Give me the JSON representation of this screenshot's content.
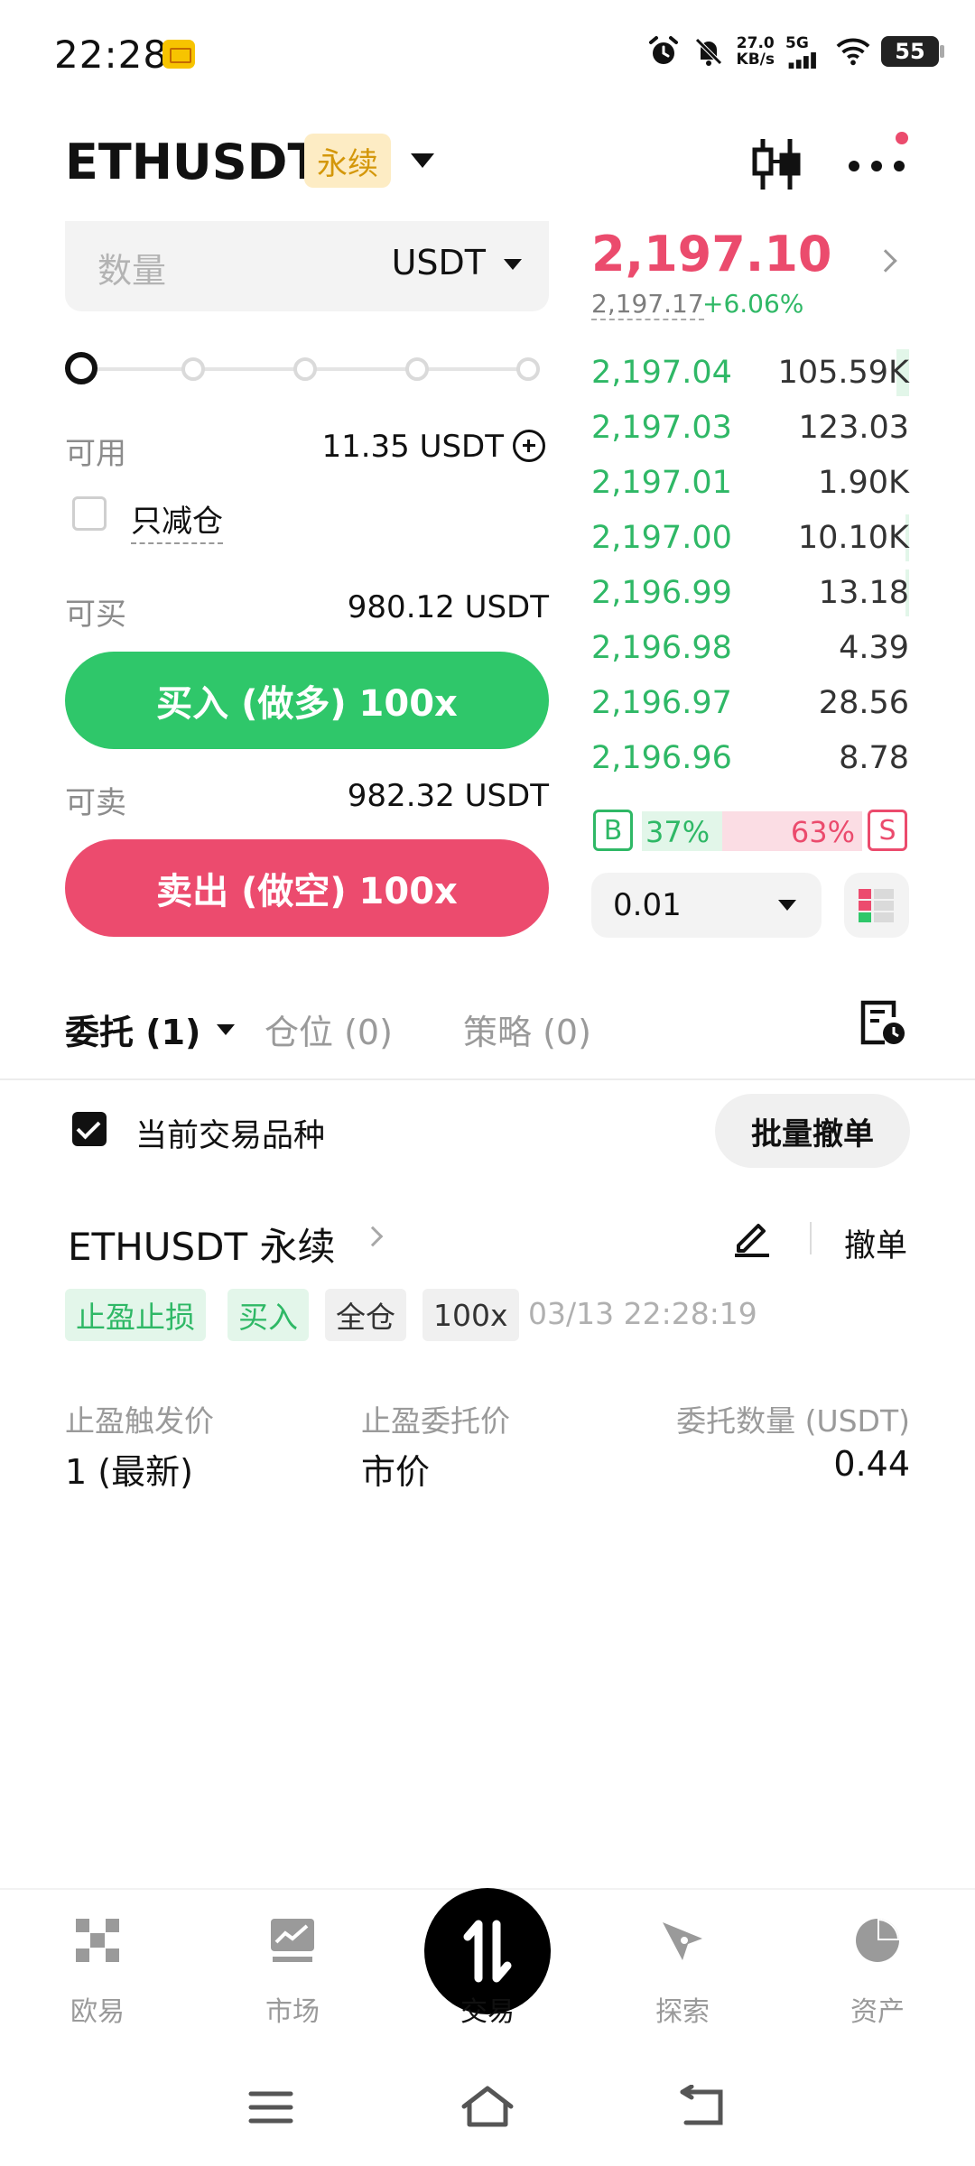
{
  "status_bar": {
    "time": "22:28",
    "net_speed_value": "27.0",
    "net_speed_unit": "KB/s",
    "network": "5G",
    "battery": "55"
  },
  "header": {
    "symbol": "ETHUSDT",
    "contract_type": "永续"
  },
  "order_form": {
    "quantity_placeholder": "数量",
    "quantity_unit": "USDT",
    "slider_value": 0,
    "available_label": "可用",
    "available_value": "11.35 USDT",
    "reduce_only_label": "只减仓",
    "buyable_label": "可买",
    "buyable_value": "980.12 USDT",
    "buy_button": "买入 (做多) 100x",
    "sellable_label": "可卖",
    "sellable_value": "982.32 USDT",
    "sell_button": "卖出 (做空) 100x"
  },
  "order_book": {
    "last_price": "2,197.10",
    "mark_price": "2,197.17",
    "change_pct": "+6.06%",
    "bids": [
      {
        "price": "2,197.04",
        "qty": "105.59K",
        "depth": 0.04
      },
      {
        "price": "2,197.03",
        "qty": "123.03",
        "depth": 0.0
      },
      {
        "price": "2,197.01",
        "qty": "1.90K",
        "depth": 0.0
      },
      {
        "price": "2,197.00",
        "qty": "10.10K",
        "depth": 0.01
      },
      {
        "price": "2,196.99",
        "qty": "13.18",
        "depth": 0.01
      },
      {
        "price": "2,196.98",
        "qty": "4.39",
        "depth": 0.0
      },
      {
        "price": "2,196.97",
        "qty": "28.56",
        "depth": 0.0
      },
      {
        "price": "2,196.96",
        "qty": "8.78",
        "depth": 0.0
      }
    ],
    "buy_marker": "B",
    "buy_ratio": "37%",
    "sell_ratio": "63%",
    "sell_marker": "S",
    "buy_ratio_value": 0.37,
    "precision": "0.01"
  },
  "tabs": [
    {
      "label": "委托 (1)",
      "active": true
    },
    {
      "label": "仓位 (0)",
      "active": false
    },
    {
      "label": "策略 (0)",
      "active": false
    }
  ],
  "orders_filter": {
    "current_symbol_label": "当前交易品种",
    "batch_cancel": "批量撤单"
  },
  "order": {
    "title": "ETHUSDT 永续",
    "cancel": "撤单",
    "tags": [
      "止盈止损",
      "买入",
      "全仓",
      "100x"
    ],
    "time": "03/13 22:28:19",
    "fields": [
      {
        "label": "止盈触发价",
        "value": "1 (最新)"
      },
      {
        "label": "止盈委托价",
        "value": "市价"
      },
      {
        "label": "委托数量 (USDT)",
        "value": "0.44"
      }
    ]
  },
  "bottom_nav": [
    {
      "label": "欧易",
      "icon": "okx-logo-icon"
    },
    {
      "label": "市场",
      "icon": "chart-icon"
    },
    {
      "label": "交易",
      "icon": "swap-vertical-icon",
      "active": true
    },
    {
      "label": "探索",
      "icon": "compass-icon"
    },
    {
      "label": "资产",
      "icon": "pie-chart-icon"
    }
  ],
  "colors": {
    "buy": "#2fc76a",
    "sell": "#ec4b6e",
    "perp_badge_bg": "#fdecc4",
    "perp_badge_text": "#d4970a"
  }
}
